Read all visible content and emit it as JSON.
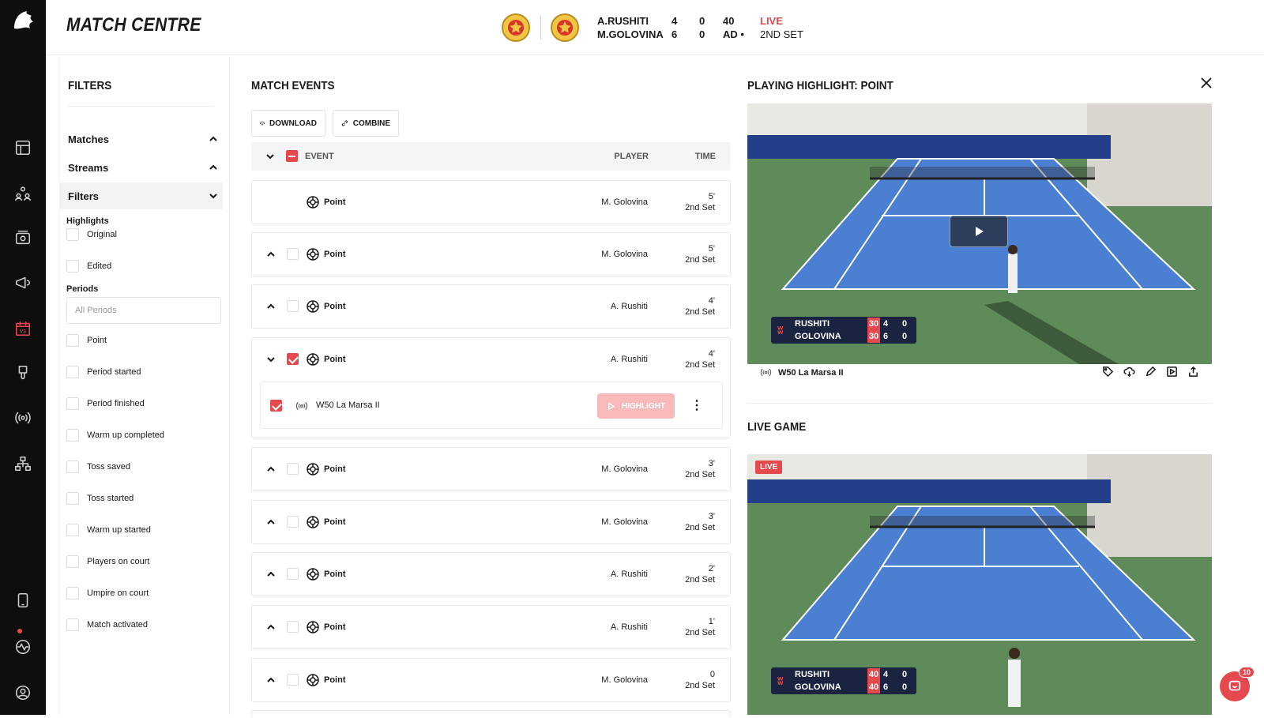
{
  "app": {
    "title": "MATCH CENTRE"
  },
  "scoreboard": {
    "players": [
      {
        "name": "A.RUSHITI",
        "sets": "4",
        "games": "0",
        "points": "40"
      },
      {
        "name": "M.GOLOVINA",
        "sets": "6",
        "games": "0",
        "points": "AD •"
      }
    ],
    "status": "LIVE",
    "set_label": "2ND SET"
  },
  "filters": {
    "title": "FILTERS",
    "sections": [
      {
        "label": "Matches"
      },
      {
        "label": "Streams"
      },
      {
        "label": "Filters"
      }
    ],
    "highlights_label": "Highlights",
    "highlight_options": [
      "Original",
      "Edited"
    ],
    "periods_label": "Periods",
    "periods_placeholder": "All Periods",
    "event_types": [
      "Point",
      "Period started",
      "Period finished",
      "Warm up completed",
      "Toss saved",
      "Toss started",
      "Warm up started",
      "Players on court",
      "Umpire on court",
      "Match activated"
    ]
  },
  "events": {
    "title": "MATCH EVENTS",
    "download_label": "DOWNLOAD",
    "combine_label": "COMBINE",
    "columns": {
      "event": "EVENT",
      "player": "PLAYER",
      "time": "TIME"
    },
    "rows": [
      {
        "event": "Point",
        "player": "M. Golovina",
        "minute": "5'",
        "set": "2nd Set"
      },
      {
        "event": "Point",
        "player": "M. Golovina",
        "minute": "5'",
        "set": "2nd Set"
      },
      {
        "event": "Point",
        "player": "A. Rushiti",
        "minute": "4'",
        "set": "2nd Set"
      },
      {
        "event": "Point",
        "player": "A. Rushiti",
        "minute": "4'",
        "set": "2nd Set"
      },
      {
        "event": "Point",
        "player": "M. Golovina",
        "minute": "3'",
        "set": "2nd Set"
      },
      {
        "event": "Point",
        "player": "M. Golovina",
        "minute": "3'",
        "set": "2nd Set"
      },
      {
        "event": "Point",
        "player": "A. Rushiti",
        "minute": "2'",
        "set": "2nd Set"
      },
      {
        "event": "Point",
        "player": "A. Rushiti",
        "minute": "1'",
        "set": "2nd Set"
      },
      {
        "event": "Point",
        "player": "M. Golovina",
        "minute": "0",
        "set": "2nd Set"
      }
    ],
    "expanded": {
      "stream": "W50 La Marsa II",
      "highlight_label": "HIGHLIGHT"
    }
  },
  "highlight": {
    "title": "PLAYING HIGHLIGHT: POINT",
    "stream": "W50 La Marsa II",
    "overlay": [
      {
        "name": "RUSHITI",
        "points": "30",
        "games": "4",
        "sets": "0"
      },
      {
        "name": "GOLOVINA",
        "points": "30",
        "games": "6",
        "sets": "0"
      }
    ]
  },
  "live_game": {
    "title": "LIVE GAME",
    "badge": "LIVE",
    "overlay": [
      {
        "name": "RUSHITI",
        "points": "40",
        "games": "4",
        "sets": "0"
      },
      {
        "name": "GOLOVINA",
        "points": "40",
        "games": "6",
        "sets": "0"
      }
    ]
  },
  "chat": {
    "badge": "10"
  },
  "colors": {
    "accent": "#e5484d",
    "sidebar": "#0e0e0e",
    "court": "#4a7fd1",
    "surround": "#5f8a59"
  }
}
